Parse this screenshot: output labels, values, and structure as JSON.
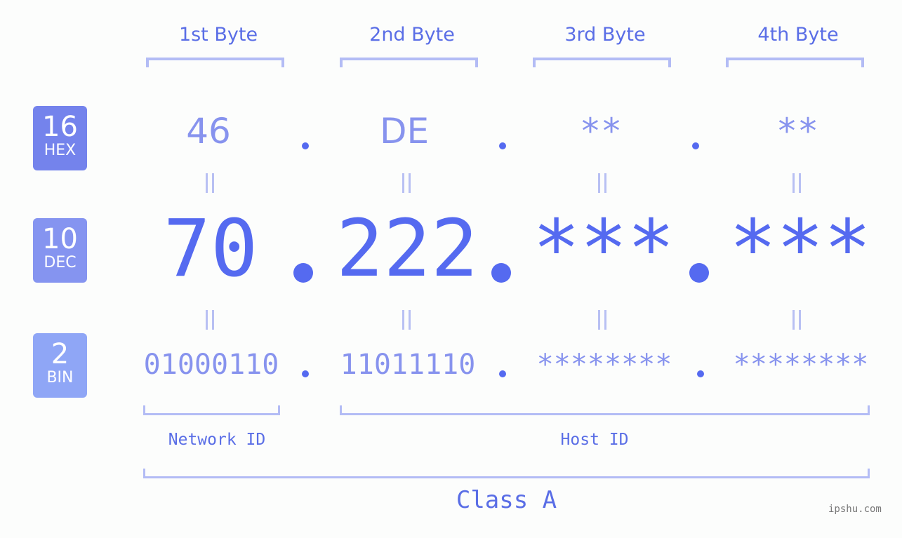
{
  "bytes": [
    {
      "header": "1st Byte",
      "hex": "46",
      "dec": "70",
      "bin": "01000110"
    },
    {
      "header": "2nd Byte",
      "hex": "DE",
      "dec": "222",
      "bin": "11011110"
    },
    {
      "header": "3rd Byte",
      "hex": "**",
      "dec": "***",
      "bin": "********"
    },
    {
      "header": "4th Byte",
      "hex": "**",
      "dec": "***",
      "bin": "********"
    }
  ],
  "badges": {
    "hex": {
      "base": "16",
      "label": "HEX",
      "color": "#7483ec"
    },
    "dec": {
      "base": "10",
      "label": "DEC",
      "color": "#8594f0"
    },
    "bin": {
      "base": "2",
      "label": "BIN",
      "color": "#8fa6f6"
    }
  },
  "network_label": "Network ID",
  "host_label": "Host ID",
  "class_label": "Class A",
  "watermark": "ipshu.com",
  "colors": {
    "accent": "#556af0",
    "text_light": "#8793ee",
    "bracket": "#b3bcf5",
    "equals": "#b8c0f3"
  }
}
